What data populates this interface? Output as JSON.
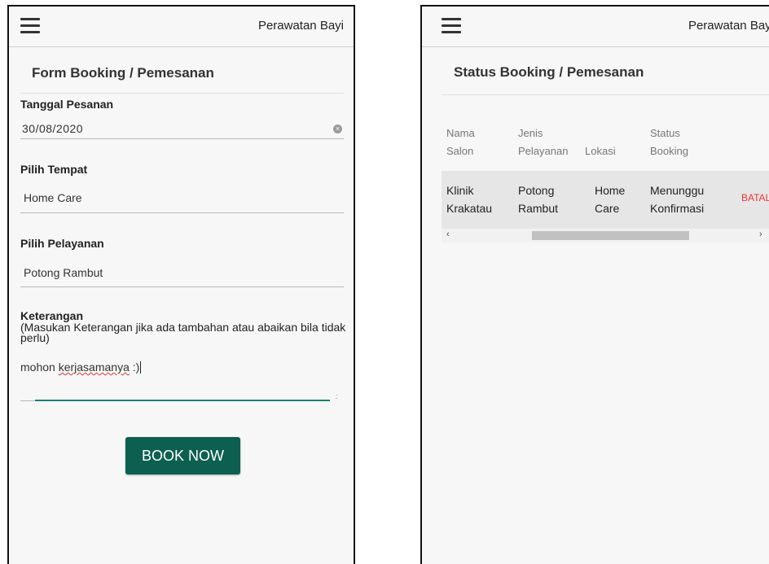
{
  "left_screen": {
    "app_title": "Perawatan Bayi",
    "form_title": "Form Booking / Pemesanan",
    "tanggal": {
      "label": "Tanggal Pesanan",
      "value": "30/08/2020"
    },
    "tempat": {
      "label": "Pilih Tempat",
      "value": "Home Care"
    },
    "pelayanan": {
      "label": "Pilih Pelayanan",
      "value": "Potong Rambut"
    },
    "keterangan": {
      "label": "Keterangan",
      "hint": "(Masukan Keterangan jika ada tambahan atau abaikan bila tidak perlu)",
      "value_prefix": "mohon ",
      "value_misspelled": "kerjasamanya",
      "value_suffix": " :)"
    },
    "book_button": "BOOK NOW"
  },
  "right_screen": {
    "app_title": "Perawatan Bayi",
    "status_title": "Status Booking / Pemesanan",
    "table": {
      "headers": [
        [
          "Nama",
          "Salon"
        ],
        [
          "Jenis",
          "Pelayanan"
        ],
        [
          "Lokasi"
        ],
        [
          "Status",
          "Booking"
        ]
      ],
      "row": [
        [
          "Klinik",
          "Krakatau"
        ],
        [
          "Potong",
          "Rambut"
        ],
        [
          "Home",
          "Care"
        ],
        [
          "Menunggu",
          "Konfirmasi"
        ]
      ],
      "action": "BATAL"
    }
  },
  "colors": {
    "primary": "#0d5f50",
    "accent_underline": "#16826f",
    "danger": "#e53935",
    "background": "#f7f7f7"
  },
  "icons": [
    "menu-icon",
    "clear-icon",
    "scroll-left-icon",
    "scroll-right-icon"
  ]
}
